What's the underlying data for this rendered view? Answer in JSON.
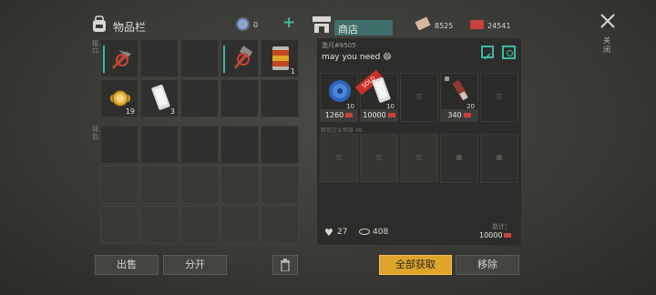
{
  "inventory": {
    "title": "物品栏",
    "coin_count": "0",
    "side_label_top": "接口",
    "side_label_bottom": "背包",
    "slots": [
      {
        "icon": "pickaxe-icon",
        "count": ""
      },
      {
        "icon": "",
        "count": ""
      },
      {
        "icon": "",
        "count": ""
      },
      {
        "icon": "hammer-icon",
        "count": ""
      },
      {
        "icon": "canned-food-icon",
        "count": "1"
      },
      {
        "icon": "gold-watch-icon",
        "count": "19"
      },
      {
        "icon": "smartphone-icon",
        "count": "3"
      }
    ],
    "sell_button": "出售",
    "split_button": "分开"
  },
  "shop": {
    "title": "商店",
    "currency1": "8525",
    "currency2": "24541",
    "owner": "激月",
    "owner_id": "#6505",
    "message": "may you need 😄",
    "items": [
      {
        "icon": "wire-spool-icon",
        "count": "10",
        "price": "1260"
      },
      {
        "icon": "smartphone-icon",
        "count": "10",
        "price": "10000",
        "badge": "SOLD"
      },
      {
        "icon": "",
        "count": "",
        "price": "",
        "empty_label": "空"
      },
      {
        "icon": "syringe-icon",
        "count": "20",
        "price": "340"
      },
      {
        "icon": "",
        "count": "",
        "price": "",
        "empty_label": "空"
      }
    ],
    "unlock_hint": "解锁企业等级 49",
    "row2_empty_label": "空",
    "likes": "27",
    "views": "408",
    "total_label": "总计：",
    "total_value": "10000",
    "buy_all_button": "全部获取",
    "remove_button": "移除",
    "close_label": "关闭"
  },
  "colors": {
    "accent": "#e0a42a",
    "teal": "#3fb7a4",
    "ticket_red": "#c9413c"
  }
}
